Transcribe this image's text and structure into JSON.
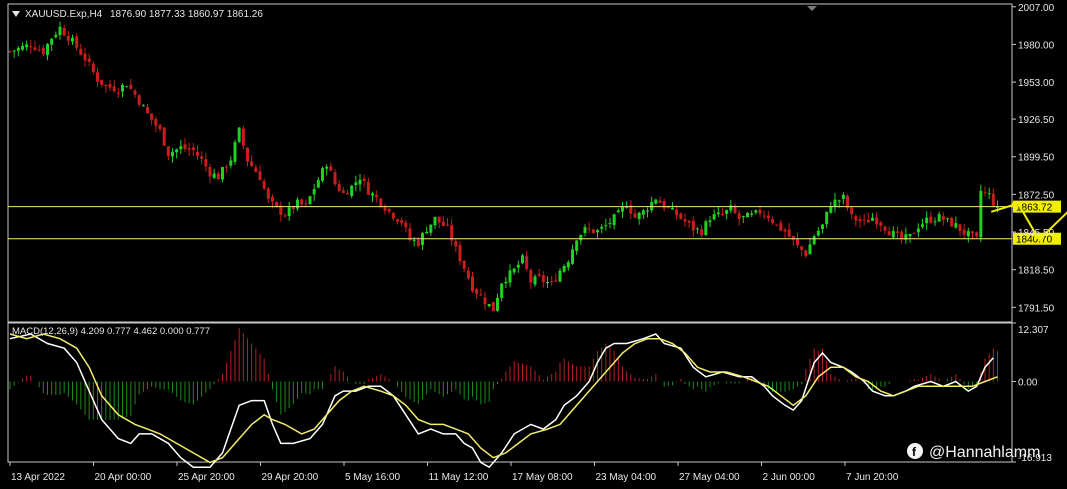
{
  "colors": {
    "background": "#000000",
    "axis": "#c8c8c8",
    "bull": "#1fd21f",
    "bear": "#c81e1e",
    "macd_line": "#ffffff",
    "signal_line": "#f2ec6a",
    "hist_pos": "#b82020",
    "hist_neg": "#1c8a1c",
    "level_line": "#f0ec78",
    "level_label_bg": "#f2ee00",
    "forecast": "#f2ec00"
  },
  "header": {
    "symbol_label": "XAUUSD.Exp,H4",
    "ohlc": "1876.90 1877.33 1860.97 1861.26",
    "dropdown_icon": "triangle-down-icon"
  },
  "watermark": {
    "icon": "facebook-icon",
    "text": "@Hannahlamm"
  },
  "chart_data": [
    {
      "type": "candlestick",
      "title": "XAUUSD.Exp,H4",
      "ohlc_readout": [
        1876.9,
        1877.33,
        1860.97,
        1861.26
      ],
      "y_ticks": [
        2007.0,
        1980.0,
        1953.0,
        1926.5,
        1899.5,
        1872.5,
        1845.5,
        1818.5,
        1791.5
      ],
      "y_tick_labels": [
        "2007.00",
        "1980.00",
        "1953.00",
        "1926.50",
        "1899.50",
        "1872.50",
        "1845.50",
        "1818.50",
        "1791.50"
      ],
      "ylim": [
        1781,
        2009
      ],
      "x_ticks": [
        "13 Apr 2022",
        "20 Apr 00:00",
        "25 Apr 20:00",
        "29 Apr 20:00",
        "5 May 16:00",
        "11 May 12:00",
        "17 May 08:00",
        "23 May 04:00",
        "27 May 04:00",
        "2 Jun 00:00",
        "7 Jun 20:00"
      ],
      "close_path": [
        [
          0,
          1975
        ],
        [
          5,
          1980
        ],
        [
          8,
          1975
        ],
        [
          10,
          1985
        ],
        [
          12,
          1992
        ],
        [
          15,
          1982
        ],
        [
          18,
          1970
        ],
        [
          21,
          1955
        ],
        [
          23,
          1950
        ],
        [
          26,
          1948
        ],
        [
          28,
          1952
        ],
        [
          30,
          1944
        ],
        [
          33,
          1930
        ],
        [
          36,
          1918
        ],
        [
          38,
          1902
        ],
        [
          41,
          1906
        ],
        [
          44,
          1904
        ],
        [
          46,
          1897
        ],
        [
          48,
          1888
        ],
        [
          50,
          1885
        ],
        [
          53,
          1898
        ],
        [
          55,
          1918
        ],
        [
          57,
          1897
        ],
        [
          60,
          1885
        ],
        [
          62,
          1868
        ],
        [
          64,
          1862
        ],
        [
          66,
          1858
        ],
        [
          69,
          1866
        ],
        [
          71,
          1864
        ],
        [
          73,
          1877
        ],
        [
          76,
          1895
        ],
        [
          78,
          1880
        ],
        [
          80,
          1873
        ],
        [
          82,
          1878
        ],
        [
          84,
          1885
        ],
        [
          86,
          1875
        ],
        [
          89,
          1867
        ],
        [
          91,
          1860
        ],
        [
          94,
          1853
        ],
        [
          96,
          1840
        ],
        [
          98,
          1838
        ],
        [
          100,
          1848
        ],
        [
          102,
          1855
        ],
        [
          105,
          1848
        ],
        [
          107,
          1833
        ],
        [
          109,
          1820
        ],
        [
          111,
          1806
        ],
        [
          114,
          1796
        ],
        [
          116,
          1790
        ],
        [
          118,
          1810
        ],
        [
          121,
          1818
        ],
        [
          123,
          1826
        ],
        [
          125,
          1810
        ],
        [
          127,
          1812
        ],
        [
          130,
          1808
        ],
        [
          132,
          1818
        ],
        [
          134,
          1826
        ],
        [
          136,
          1842
        ],
        [
          138,
          1847
        ],
        [
          141,
          1846
        ],
        [
          143,
          1850
        ],
        [
          146,
          1858
        ],
        [
          148,
          1866
        ],
        [
          150,
          1856
        ],
        [
          152,
          1860
        ],
        [
          155,
          1870
        ],
        [
          157,
          1864
        ],
        [
          160,
          1858
        ],
        [
          162,
          1853
        ],
        [
          164,
          1848
        ],
        [
          166,
          1846
        ],
        [
          168,
          1856
        ],
        [
          171,
          1858
        ],
        [
          173,
          1862
        ],
        [
          175,
          1855
        ],
        [
          178,
          1857
        ],
        [
          180,
          1860
        ],
        [
          182,
          1857
        ],
        [
          184,
          1850
        ],
        [
          186,
          1846
        ],
        [
          189,
          1835
        ],
        [
          191,
          1830
        ],
        [
          193,
          1843
        ],
        [
          195,
          1850
        ],
        [
          197,
          1866
        ],
        [
          200,
          1870
        ],
        [
          202,
          1856
        ],
        [
          205,
          1852
        ],
        [
          207,
          1856
        ],
        [
          209,
          1852
        ],
        [
          211,
          1846
        ],
        [
          214,
          1840
        ],
        [
          216,
          1842
        ],
        [
          218,
          1850
        ],
        [
          220,
          1854
        ],
        [
          223,
          1856
        ],
        [
          225,
          1853
        ],
        [
          227,
          1850
        ],
        [
          229,
          1845
        ],
        [
          232,
          1840
        ],
        [
          233,
          1875
        ],
        [
          235,
          1872
        ],
        [
          237,
          1861
        ]
      ],
      "series": [
        {
          "name": "",
          "kind": "forecast",
          "values": [
            1860,
            1866,
            1840,
            1866
          ]
        }
      ],
      "price_lines": [
        {
          "value": 1863.72,
          "label": "1863.72"
        },
        {
          "value": 1840.7,
          "label": "1840.70"
        }
      ]
    },
    {
      "type": "line",
      "title": "MACD(12,26,9)",
      "readout": "MACD(12,26,9) 4.209 0.777 4.462 0.000 0.777",
      "y_tick_labels": [
        "12.307",
        "0.00",
        "-16.913"
      ],
      "y_ticks": [
        12.307,
        0.0,
        -16.913
      ],
      "ylim": [
        -16.913,
        12.307
      ],
      "series": [
        {
          "name": "MACD",
          "points": [
            [
              0,
              9
            ],
            [
              5,
              10
            ],
            [
              9,
              8
            ],
            [
              13,
              7
            ],
            [
              16,
              4
            ],
            [
              19,
              -2
            ],
            [
              22,
              -8
            ],
            [
              26,
              -12
            ],
            [
              29,
              -13
            ],
            [
              31,
              -11
            ],
            [
              34,
              -11
            ],
            [
              38,
              -13
            ],
            [
              41,
              -16
            ],
            [
              44,
              -18
            ],
            [
              48,
              -18
            ],
            [
              51,
              -15
            ],
            [
              53,
              -10
            ],
            [
              55,
              -5
            ],
            [
              58,
              -4
            ],
            [
              61,
              -4
            ],
            [
              63,
              -9
            ],
            [
              65,
              -13
            ],
            [
              68,
              -13
            ],
            [
              72,
              -12
            ],
            [
              75,
              -9
            ],
            [
              78,
              -3
            ],
            [
              80,
              -2
            ],
            [
              83,
              -2
            ],
            [
              86,
              -1
            ],
            [
              89,
              -1
            ],
            [
              92,
              -3
            ],
            [
              95,
              -7
            ],
            [
              98,
              -11
            ],
            [
              101,
              -10
            ],
            [
              104,
              -11
            ],
            [
              107,
              -11
            ],
            [
              109,
              -13
            ],
            [
              111,
              -14
            ],
            [
              113,
              -17
            ],
            [
              115,
              -18
            ],
            [
              118,
              -15
            ],
            [
              121,
              -11
            ],
            [
              125,
              -9
            ],
            [
              128,
              -10
            ],
            [
              131,
              -8
            ],
            [
              133,
              -5
            ],
            [
              136,
              -3
            ],
            [
              139,
              0
            ],
            [
              141,
              4
            ],
            [
              143,
              7
            ],
            [
              145,
              8
            ],
            [
              148,
              8
            ],
            [
              152,
              9
            ],
            [
              155,
              10
            ],
            [
              157,
              8
            ],
            [
              161,
              7
            ],
            [
              164,
              3
            ],
            [
              167,
              1
            ],
            [
              171,
              2
            ],
            [
              175,
              1
            ],
            [
              178,
              1
            ],
            [
              181,
              -1
            ],
            [
              183,
              -3
            ],
            [
              186,
              -5
            ],
            [
              188,
              -6
            ],
            [
              190,
              -4
            ],
            [
              193,
              4
            ],
            [
              195,
              6
            ],
            [
              197,
              4
            ],
            [
              200,
              3
            ],
            [
              202,
              2
            ],
            [
              205,
              0
            ],
            [
              207,
              -2
            ],
            [
              210,
              -3
            ],
            [
              212,
              -3
            ],
            [
              215,
              -2
            ],
            [
              217,
              -1
            ],
            [
              221,
              0
            ],
            [
              224,
              -1
            ],
            [
              227,
              0
            ],
            [
              230,
              -2
            ],
            [
              232,
              -1
            ],
            [
              234,
              3
            ],
            [
              236,
              5
            ]
          ]
        },
        {
          "name": "Signal",
          "points": [
            [
              0,
              10
            ],
            [
              4,
              9
            ],
            [
              8,
              10
            ],
            [
              12,
              9
            ],
            [
              16,
              7
            ],
            [
              19,
              3
            ],
            [
              22,
              -3
            ],
            [
              26,
              -7
            ],
            [
              30,
              -9
            ],
            [
              33,
              -10
            ],
            [
              36,
              -11
            ],
            [
              40,
              -13
            ],
            [
              44,
              -15
            ],
            [
              48,
              -17
            ],
            [
              51,
              -16
            ],
            [
              54,
              -13
            ],
            [
              58,
              -9
            ],
            [
              61,
              -7
            ],
            [
              63,
              -8
            ],
            [
              66,
              -9
            ],
            [
              70,
              -11
            ],
            [
              73,
              -10
            ],
            [
              76,
              -7
            ],
            [
              79,
              -4
            ],
            [
              82,
              -2
            ],
            [
              85,
              -1
            ],
            [
              89,
              -2
            ],
            [
              92,
              -3
            ],
            [
              95,
              -5
            ],
            [
              98,
              -8
            ],
            [
              101,
              -9
            ],
            [
              104,
              -9
            ],
            [
              107,
              -10
            ],
            [
              110,
              -11
            ],
            [
              113,
              -14
            ],
            [
              116,
              -16
            ],
            [
              119,
              -15
            ],
            [
              122,
              -13
            ],
            [
              125,
              -11
            ],
            [
              129,
              -10
            ],
            [
              132,
              -9
            ],
            [
              135,
              -6
            ],
            [
              138,
              -3
            ],
            [
              141,
              0
            ],
            [
              144,
              3
            ],
            [
              147,
              6
            ],
            [
              150,
              8
            ],
            [
              153,
              9
            ],
            [
              156,
              9
            ],
            [
              159,
              8
            ],
            [
              162,
              6
            ],
            [
              165,
              3
            ],
            [
              168,
              2
            ],
            [
              172,
              2
            ],
            [
              176,
              1
            ],
            [
              179,
              0
            ],
            [
              182,
              -1
            ],
            [
              185,
              -3
            ],
            [
              188,
              -5
            ],
            [
              191,
              -3
            ],
            [
              194,
              1
            ],
            [
              197,
              3
            ],
            [
              200,
              3
            ],
            [
              203,
              1
            ],
            [
              206,
              0
            ],
            [
              209,
              -2
            ],
            [
              212,
              -3
            ],
            [
              215,
              -2
            ],
            [
              218,
              -1
            ],
            [
              222,
              -1
            ],
            [
              225,
              -1
            ],
            [
              228,
              -1
            ],
            [
              231,
              -1
            ],
            [
              234,
              0
            ],
            [
              237,
              1
            ]
          ]
        }
      ]
    }
  ]
}
